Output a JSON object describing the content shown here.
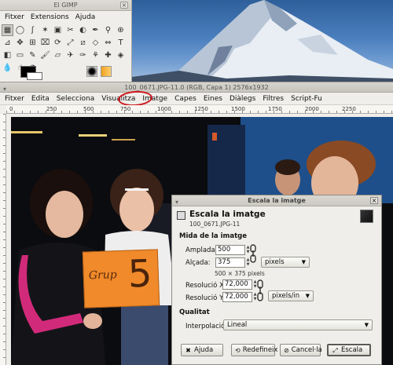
{
  "toolbox": {
    "title": "El GIMP",
    "menu": [
      "Fitxer",
      "Extensions",
      "Ajuda"
    ],
    "tools": [
      "rect-select-icon",
      "ellipse-select-icon",
      "free-select-icon",
      "fuzzy-select-icon",
      "color-select-icon",
      "scissors-icon",
      "foreground-select-icon",
      "paths-icon",
      "color-picker-icon",
      "zoom-icon",
      "measure-icon",
      "move-icon",
      "align-icon",
      "crop-icon",
      "rotate-icon",
      "scale-icon",
      "shear-icon",
      "perspective-icon",
      "flip-icon",
      "text-icon",
      "bucket-fill-icon",
      "blend-icon",
      "pencil-icon",
      "paintbrush-icon",
      "eraser-icon",
      "airbrush-icon",
      "ink-icon",
      "clone-icon",
      "heal-icon",
      "perspective-clone-icon",
      "blur-icon",
      "smudge-icon",
      "dodge-burn-icon"
    ],
    "tool_glyphs": [
      "▦",
      "◯",
      "ʃ",
      "✶",
      "▣",
      "✂",
      "◐",
      "✒",
      "⚲",
      "⊕",
      "⊿",
      "✥",
      "⊞",
      "⌧",
      "⟳",
      "⤢",
      "⧄",
      "◇",
      "⇔",
      "T",
      "◧",
      "▭",
      "✎",
      "🖌",
      "▱",
      "✈",
      "✑",
      "⚘",
      "✚",
      "◈",
      "💧",
      "☝",
      "◔"
    ]
  },
  "image_window": {
    "title": "100_0671.JPG-11.0 (RGB, Capa 1) 2576x1932",
    "menu": [
      {
        "label": "Fitxer",
        "u": "F"
      },
      {
        "label": "Edita",
        "u": "E"
      },
      {
        "label": "Selecciona",
        "u": "S"
      },
      {
        "label": "Visualitza",
        "u": "V"
      },
      {
        "label": "Imatge",
        "u": "I"
      },
      {
        "label": "Capes",
        "u": "C"
      },
      {
        "label": "Eines",
        "u": "E"
      },
      {
        "label": "Diàlegs",
        "u": "D"
      },
      {
        "label": "Filtres",
        "u": "l"
      },
      {
        "label": "Script-Fu",
        "u": ""
      }
    ],
    "ruler_ticks": [
      "0",
      "250",
      "500",
      "750",
      "1000",
      "1250",
      "1500",
      "1750",
      "2000",
      "2250"
    ],
    "photo_sign": {
      "left_text": "Grup",
      "big_text": "5"
    }
  },
  "dialog": {
    "window_title": "Escala la imatge",
    "heading": "Escala la imatge",
    "subheading": "100_0671.JPG-11",
    "size_section": "Mida de la imatge",
    "width_label": "Amplada:",
    "width_value": "500",
    "height_label": "Alçada:",
    "height_value": "375",
    "unit": "pixels",
    "size_note": "500 × 375 pixels",
    "resx_label": "Resolució X:",
    "resx_value": "72,000",
    "resy_label": "Resolució Y:",
    "resy_value": "72,000",
    "res_unit": "pixels/in",
    "quality_section": "Qualitat",
    "interp_label": "Interpolació:",
    "interp_value": "Lineal",
    "buttons": {
      "help": "Ajuda",
      "reset": "Redefineix",
      "cancel": "Cancel·la",
      "scale": "Escala"
    }
  },
  "colors": {
    "highlight_circle": "#d0151b",
    "sign_orange": "#f08a2a"
  }
}
